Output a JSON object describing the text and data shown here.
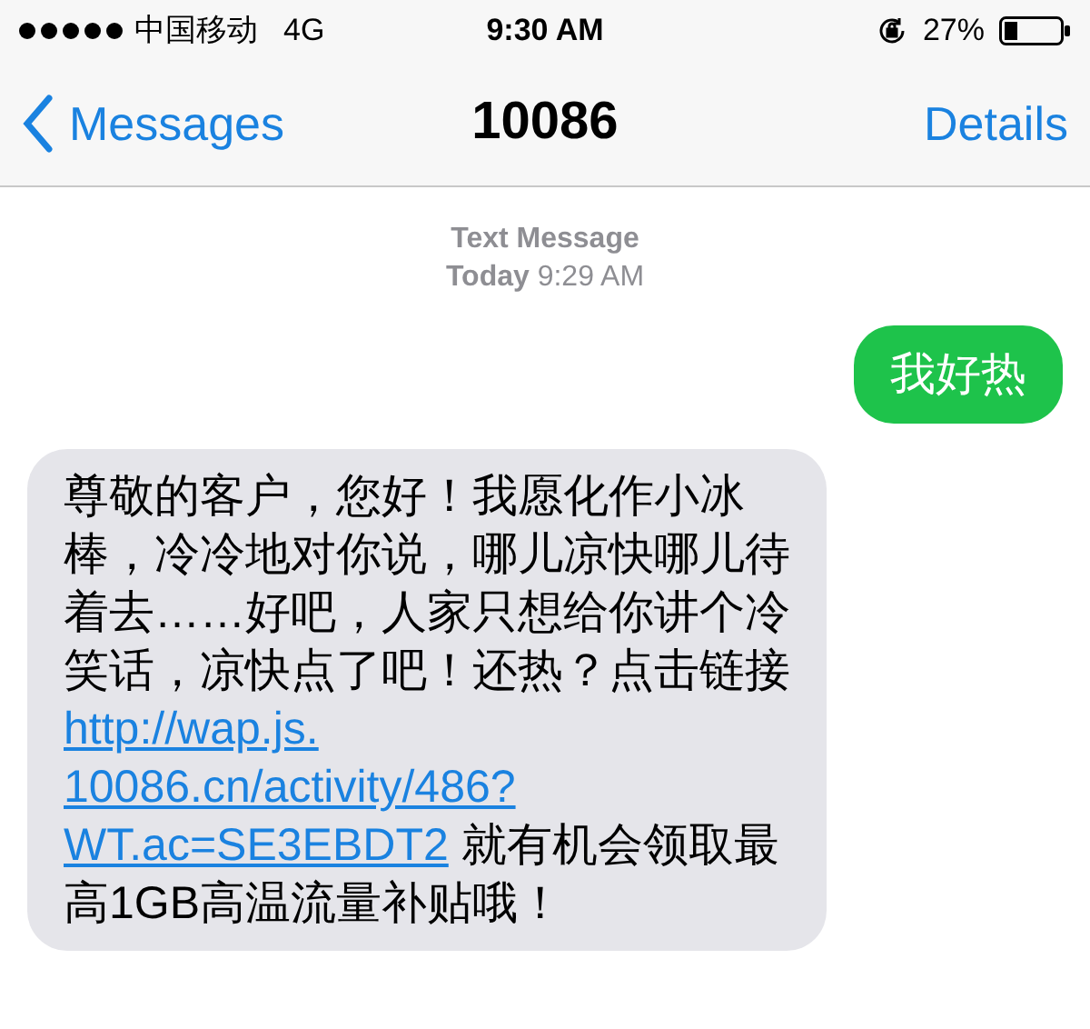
{
  "status_bar": {
    "carrier": "中国移动",
    "network": "4G",
    "time": "9:30 AM",
    "battery": "27%"
  },
  "nav": {
    "back": "Messages",
    "title": "10086",
    "action": "Details"
  },
  "header": {
    "label": "Text Message",
    "day": "Today",
    "time": "9:29 AM"
  },
  "messages": [
    {
      "kind": "sent",
      "parts": [
        {
          "kind": "text",
          "text": "我好热"
        }
      ]
    },
    {
      "kind": "received",
      "parts": [
        {
          "kind": "text",
          "text": "尊敬的客户，您好！我愿化作小冰棒，冷冷地对你说，哪儿凉快哪儿待着去……好吧，人家只想给你讲个冷笑话，凉快点了吧！还热？点击链接 "
        },
        {
          "kind": "link",
          "text": "http://wap.js."
        },
        {
          "kind": "link",
          "text": "10086.cn/activity/486?"
        },
        {
          "kind": "link",
          "text": "WT.ac=SE3EBDT2"
        },
        {
          "kind": "text",
          "text": " 就有机会领取最高1GB高温流量补贴哦！"
        }
      ]
    }
  ]
}
